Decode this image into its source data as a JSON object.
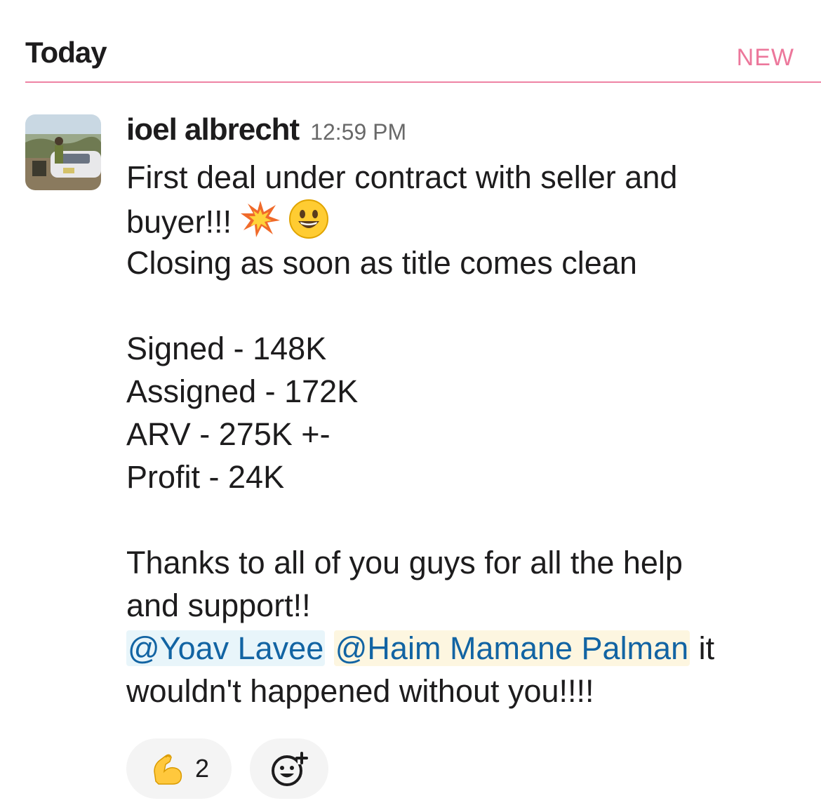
{
  "header": {
    "day": "Today",
    "new_badge": "NEW"
  },
  "message": {
    "author": "ioel albrecht",
    "time": "12:59 PM",
    "lines": {
      "l1": "First deal under contract with seller and",
      "l2": "buyer!!!",
      "l3": "Closing as soon as title comes clean",
      "l4": "Signed - 148K",
      "l5": "Assigned - 172K",
      "l6": "ARV - 275K +-",
      "l7": "Profit - 24K",
      "l8": "Thanks to all of you guys for all the help",
      "l9": "and support!!",
      "l10_rest": " it",
      "l11": "wouldn't happened without you!!!!"
    },
    "mentions": {
      "m1": "@Yoav Lavee",
      "m2": "@Haim Mamane Palman"
    },
    "emojis": [
      "collision-emoji",
      "smiley-emoji"
    ]
  },
  "reactions": [
    {
      "emoji": "flexed-biceps",
      "count": "2"
    },
    {
      "emoji": "add-reaction-icon"
    }
  ],
  "colors": {
    "new": "#e01e5a",
    "mention": "#1264a3",
    "mention_bg_1": "#e8f5fa",
    "mention_bg_2": "#fdf6e0"
  }
}
